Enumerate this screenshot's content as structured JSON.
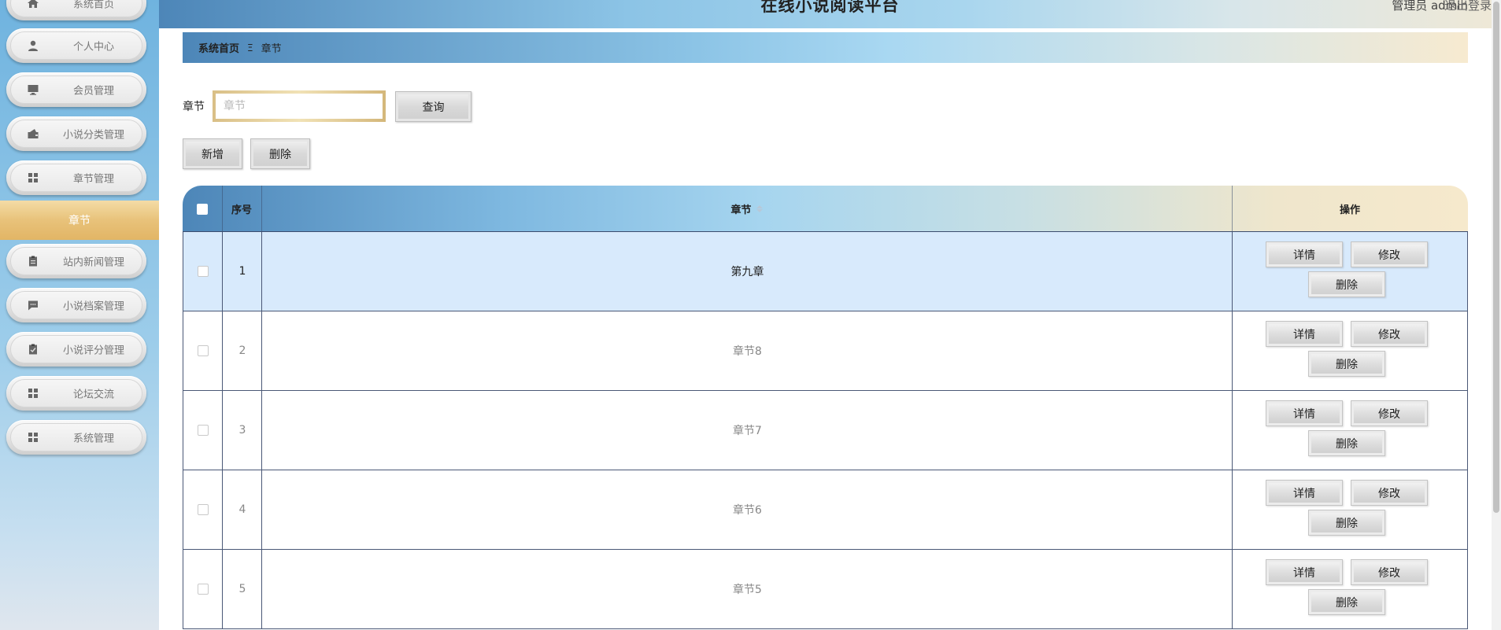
{
  "header": {
    "title": "在线小说阅读平台",
    "user": "管理员 admin",
    "logout": "退出登录"
  },
  "sidebar": {
    "items": [
      {
        "label": "系统首页",
        "icon": "home-icon"
      },
      {
        "label": "个人中心",
        "icon": "user-icon"
      },
      {
        "label": "会员管理",
        "icon": "monitor-icon"
      },
      {
        "label": "小说分类管理",
        "icon": "wallet-icon"
      },
      {
        "label": "章节管理",
        "icon": "grid-icon"
      },
      {
        "label": "站内新闻管理",
        "icon": "clipboard-icon"
      },
      {
        "label": "小说档案管理",
        "icon": "chat-icon"
      },
      {
        "label": "小说评分管理",
        "icon": "clipboard-check-icon"
      },
      {
        "label": "论坛交流",
        "icon": "grid-icon"
      },
      {
        "label": "系统管理",
        "icon": "grid-icon"
      }
    ],
    "active_sub": "章节"
  },
  "breadcrumb": {
    "home": "系统首页",
    "separator": "Ξ",
    "current": "章节"
  },
  "search": {
    "label": "章节",
    "placeholder": "章节",
    "value": "",
    "query_button": "查询"
  },
  "actions": {
    "add": "新增",
    "delete": "删除"
  },
  "table": {
    "columns": {
      "index": "序号",
      "name": "章节",
      "ops": "操作"
    },
    "rows": [
      {
        "index": "1",
        "name": "第九章"
      },
      {
        "index": "2",
        "name": "章节8"
      },
      {
        "index": "3",
        "name": "章节7"
      },
      {
        "index": "4",
        "name": "章节6"
      },
      {
        "index": "5",
        "name": "章节5"
      }
    ],
    "row_buttons": {
      "detail": "详情",
      "edit": "修改",
      "delete": "删除"
    }
  },
  "colors": {
    "active_menu": "#e8c27a",
    "highlight_row": "#d8eafc",
    "header_blue": "#4d86b8"
  }
}
